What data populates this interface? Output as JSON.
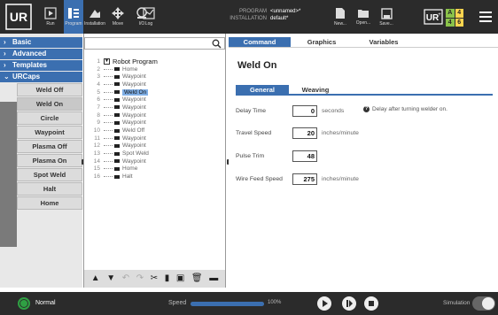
{
  "topbar": {
    "nav": [
      {
        "id": "run",
        "label": "Run"
      },
      {
        "id": "program",
        "label": "Program"
      },
      {
        "id": "installation",
        "label": "Installation"
      },
      {
        "id": "move",
        "label": "Move"
      },
      {
        "id": "io",
        "label": "I/O"
      },
      {
        "id": "log",
        "label": "Log"
      }
    ],
    "program_label": "PROGRAM",
    "program_value": "<unnamed>*",
    "installation_label": "INSTALLATION",
    "installation_value": "default*",
    "file_buttons": [
      {
        "id": "new",
        "label": "New..."
      },
      {
        "id": "open",
        "label": "Open..."
      },
      {
        "id": "save",
        "label": "Save..."
      }
    ],
    "grid_badge": [
      "A",
      "4",
      "4",
      "6"
    ],
    "icons": {
      "ur_logo": "ur-logo-icon",
      "urplus": "ur-plus-icon",
      "menu": "hamburger-menu-icon"
    }
  },
  "sidebar": {
    "categories": [
      {
        "label": "Basic",
        "expanded": false
      },
      {
        "label": "Advanced",
        "expanded": false
      },
      {
        "label": "Templates",
        "expanded": false
      },
      {
        "label": "URCaps",
        "expanded": true
      }
    ],
    "urcaps": [
      "Weld Off",
      "Weld On",
      "Circle",
      "Waypoint",
      "Plasma Off",
      "Plasma On",
      "Spot Weld",
      "Halt",
      "Home"
    ],
    "active_urcap": "Weld On"
  },
  "tree": {
    "search_placeholder": "",
    "root": "Robot Program",
    "items": [
      {
        "num": "1",
        "label": "Robot Program",
        "root": true
      },
      {
        "num": "2",
        "label": "Home"
      },
      {
        "num": "3",
        "label": "Waypoint"
      },
      {
        "num": "4",
        "label": "Waypoint"
      },
      {
        "num": "5",
        "label": "Weld On",
        "selected": true
      },
      {
        "num": "6",
        "label": "Waypoint"
      },
      {
        "num": "7",
        "label": "Waypoint"
      },
      {
        "num": "8",
        "label": "Waypoint"
      },
      {
        "num": "9",
        "label": "Waypoint"
      },
      {
        "num": "10",
        "label": "Weld Off"
      },
      {
        "num": "11",
        "label": "Waypoint"
      },
      {
        "num": "12",
        "label": "Waypoint"
      },
      {
        "num": "13",
        "label": "Spot Weld"
      },
      {
        "num": "14",
        "label": "Waypoint"
      },
      {
        "num": "15",
        "label": "Home"
      },
      {
        "num": "16",
        "label": "Halt"
      }
    ],
    "toolbar": [
      "move-up-icon",
      "move-down-icon",
      "undo-icon",
      "redo-icon",
      "cut-icon",
      "copy-icon",
      "paste-icon",
      "delete-icon",
      "suppress-icon"
    ]
  },
  "right": {
    "tabs": [
      "Command",
      "Graphics",
      "Variables"
    ],
    "active_tab": "Command",
    "title": "Weld On",
    "subtabs": [
      "General",
      "Weaving"
    ],
    "active_subtab": "General",
    "fields": [
      {
        "label": "Delay Time",
        "value": "0",
        "unit": "seconds"
      },
      {
        "label": "Travel Speed",
        "value": "20",
        "unit": "inches/minute"
      },
      {
        "label": "Pulse Trim",
        "value": "48",
        "unit": ""
      },
      {
        "label": "Wire Feed Speed",
        "value": "275",
        "unit": "inches/minute"
      }
    ],
    "hint": "Delay after turning welder on."
  },
  "bottombar": {
    "status": "Normal",
    "speed_label": "Speed",
    "speed_value": "100%",
    "speed_fraction": 1.0,
    "simulation_label": "Simulation",
    "controls": [
      "play-icon",
      "step-icon",
      "stop-icon"
    ]
  },
  "colors": {
    "accent": "#3b6fb0",
    "bar": "#2b2b2b",
    "status_green": "#2fa043"
  }
}
